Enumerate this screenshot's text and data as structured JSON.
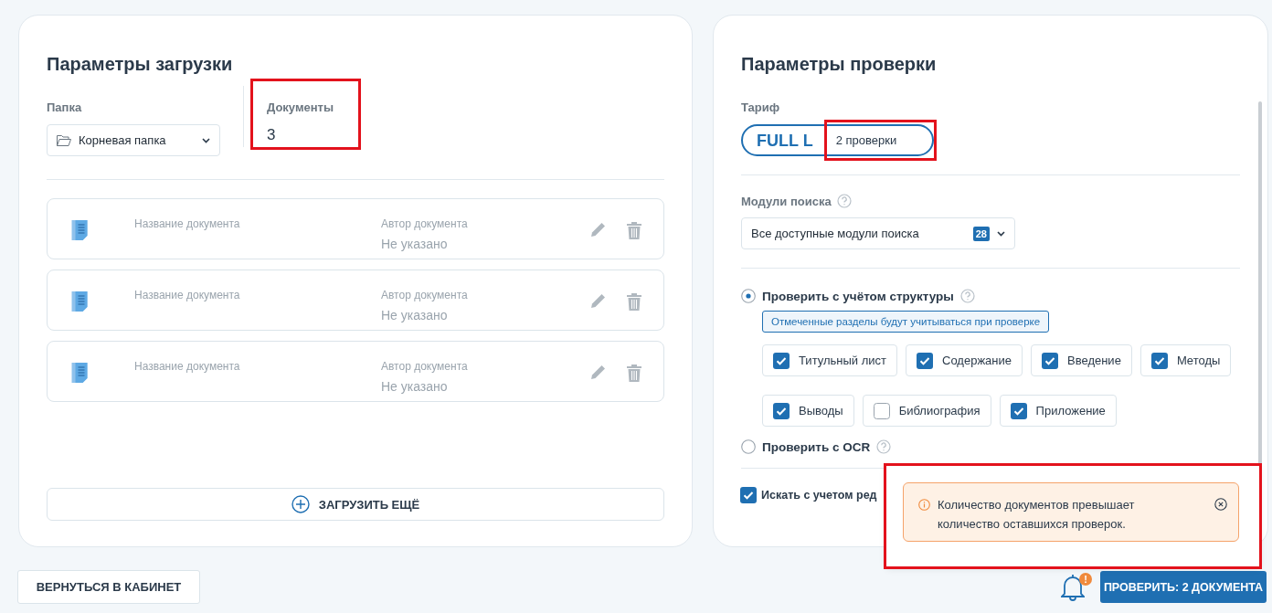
{
  "upload_params": {
    "title": "Параметры загрузки",
    "folder": {
      "label": "Папка",
      "value": "Корневая папка"
    },
    "documents": {
      "label": "Документы",
      "value": "3",
      "highlighted": true
    },
    "documents_list": [
      {
        "name_label": "Название документа",
        "author_label": "Автор документа",
        "author_value": "Не указано"
      },
      {
        "name_label": "Название документа",
        "author_label": "Автор документа",
        "author_value": "Не указано"
      },
      {
        "name_label": "Название документа",
        "author_label": "Автор документа",
        "author_value": "Не указано"
      }
    ],
    "upload_more_button": "ЗАГРУЗИТЬ ЕЩЁ"
  },
  "check_params": {
    "title": "Параметры проверки",
    "tariff": {
      "label": "Тариф",
      "plan": "FULL L",
      "checks": "2 проверки",
      "highlighted": true
    },
    "search_modules": {
      "label": "Модули поиска",
      "value": "Все доступные модули поиска",
      "count": "28"
    },
    "options": [
      {
        "label": "Проверить с учётом структуры",
        "selected": true,
        "note": "Отмеченные разделы будут учитываться при проверке",
        "sections": [
          {
            "label": "Титульный лист",
            "checked": true
          },
          {
            "label": "Содержание",
            "checked": true
          },
          {
            "label": "Введение",
            "checked": true
          },
          {
            "label": "Методы",
            "checked": true
          },
          {
            "label": "Выводы",
            "checked": true
          },
          {
            "label": "Библиография",
            "checked": false
          },
          {
            "label": "Приложение",
            "checked": true
          }
        ]
      },
      {
        "label": "Проверить с OCR",
        "selected": false
      }
    ],
    "edits_checkbox": {
      "label": "Искать с учетом ред",
      "checked": true
    }
  },
  "toast": {
    "message": "Количество документов превышает количество оставшихся проверок.",
    "highlighted": true
  },
  "footer": {
    "back_button": "ВЕРНУТЬСЯ В КАБИНЕТ",
    "notification_badge": "!",
    "submit_button": "ПРОВЕРИТЬ: 2 ДОКУМЕНТА"
  }
}
